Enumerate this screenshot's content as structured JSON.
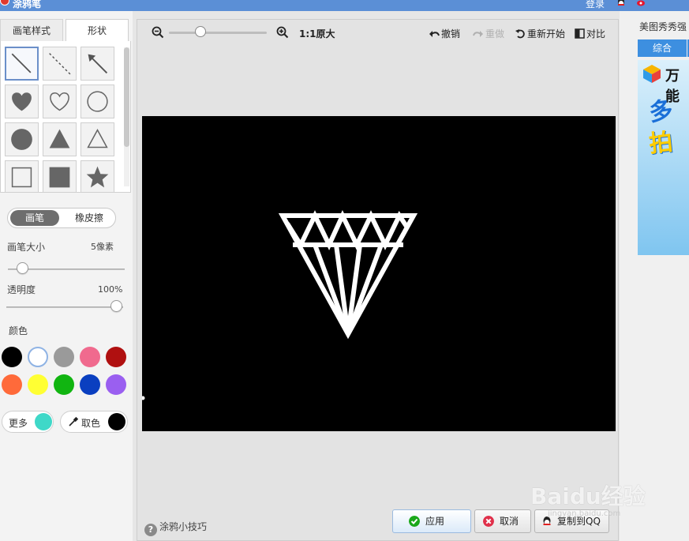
{
  "window": {
    "title": "涂鸦笔",
    "login": "登录"
  },
  "tabs": {
    "brush_style": "画笔样式",
    "shape": "形状"
  },
  "mode": {
    "brush": "画笔",
    "eraser": "橡皮擦"
  },
  "brush_size": {
    "label": "画笔大小",
    "value": "5像素",
    "level": 0.05
  },
  "opacity": {
    "label": "透明度",
    "value": "100%",
    "level": 1.0
  },
  "colors": {
    "label": "颜色",
    "swatches": [
      "#000000",
      "#ffffff",
      "#9a9a9a",
      "#f06a8e",
      "#b01010",
      "#ff6a3a",
      "#ffff33",
      "#11b511",
      "#0a3fc0",
      "#9a5ff0"
    ],
    "more_label": "更多",
    "more_color": "#3fd8c8",
    "pick_label": "取色",
    "pick_color": "#000000"
  },
  "shapes": [
    "line",
    "dashed-line",
    "arrow",
    "filled-heart",
    "outline-heart",
    "outline-circle",
    "filled-circle",
    "filled-triangle",
    "outline-triangle",
    "outline-square",
    "filled-square",
    "filled-star"
  ],
  "toolbar": {
    "zoom_label": "1:1原大",
    "zoom_level": 0.3,
    "undo": "撤销",
    "redo": "重做",
    "restart": "重新开始",
    "compare": "对比"
  },
  "footer": {
    "tips": "涂鸦小技巧",
    "apply": "应用",
    "cancel": "取消",
    "copy_qq": "复制到QQ"
  },
  "right_panel": {
    "title": "美图秀秀强",
    "tab": "综合",
    "ad_text": "万能"
  },
  "watermark": {
    "text": "Baidu经验",
    "sub": "jingyan.baidu.com"
  }
}
